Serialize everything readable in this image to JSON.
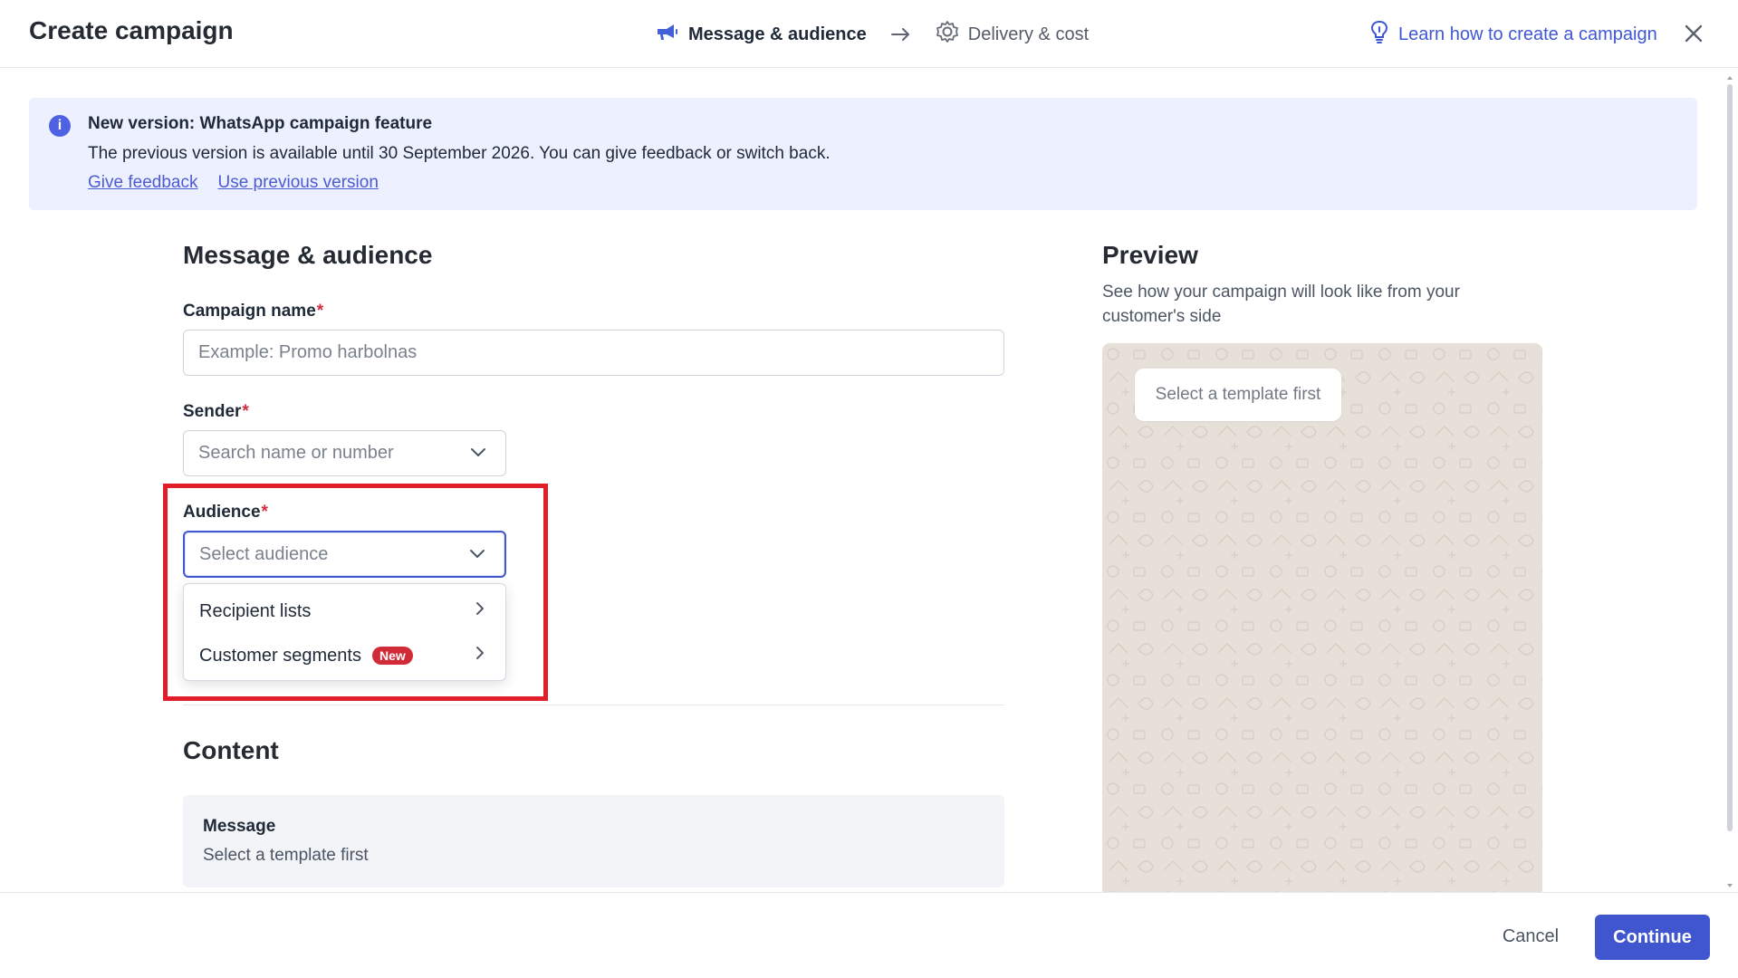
{
  "header": {
    "title": "Create campaign",
    "steps": [
      {
        "label": "Message & audience",
        "active": true,
        "icon": "megaphone-icon"
      },
      {
        "label": "Delivery & cost",
        "active": false,
        "icon": "gear-icon"
      }
    ],
    "learn_link": "Learn how to create a campaign",
    "icons": {
      "learn": "lightbulb-icon",
      "close": "close-icon"
    }
  },
  "banner": {
    "title": "New version: WhatsApp campaign feature",
    "text": "The previous version is available until 30 September 2026. You can give feedback or switch back.",
    "links": [
      "Give feedback",
      "Use previous version"
    ],
    "icon": "info-icon"
  },
  "form": {
    "section_title": "Message & audience",
    "campaign_name": {
      "label": "Campaign name",
      "required_mark": "*",
      "placeholder": "Example: Promo harbolnas"
    },
    "sender": {
      "label": "Sender",
      "required_mark": "*",
      "placeholder": "Search name or number"
    },
    "audience": {
      "label": "Audience",
      "required_mark": "*",
      "placeholder": "Select audience"
    },
    "audience_options": [
      {
        "label": "Recipient lists"
      },
      {
        "label": "Customer segments",
        "badge": "New"
      }
    ],
    "content": {
      "title": "Content",
      "message_title": "Message",
      "message_text": "Select a template first"
    }
  },
  "preview": {
    "title": "Preview",
    "subtitle": "See how your campaign will look like from your customer's side",
    "bubble_text": "Select a template first"
  },
  "footer": {
    "cancel": "Cancel",
    "continue": "Continue"
  },
  "colors": {
    "accent": "#3f56cf",
    "banner_bg": "#edf0ff",
    "highlight": "#e11d2a",
    "required": "#d12d3f"
  }
}
